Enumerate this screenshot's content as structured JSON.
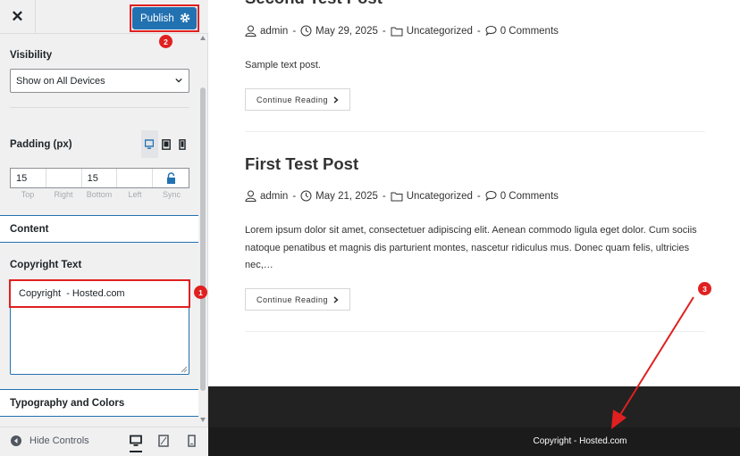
{
  "topbar": {
    "close_glyph": "✕",
    "publish_label": "Publish",
    "close_icon": "close-icon",
    "settings_icon": "gear-icon"
  },
  "panel": {
    "visibility_label": "Visibility",
    "visibility_value": "Show on All Devices",
    "padding_label": "Padding (px)",
    "padding": {
      "values": [
        "15",
        "",
        "15",
        ""
      ],
      "sub_labels": [
        "Top",
        "Right",
        "Bottom",
        "Left",
        "Sync"
      ]
    },
    "content_heading": "Content",
    "copyright_label": "Copyright Text",
    "copyright_value": "Copyright  - Hosted.com",
    "typography_heading": "Typography and Colors"
  },
  "footer_controls": {
    "hide_controls_label": "Hide Controls"
  },
  "preview": {
    "posts": [
      {
        "title": "Second Test Post",
        "author": "admin",
        "date": "May 29, 2025",
        "category": "Uncategorized",
        "comments": "0 Comments",
        "excerpt": "Sample text post.",
        "button": "Continue Reading"
      },
      {
        "title": "First Test Post",
        "author": "admin",
        "date": "May 21, 2025",
        "category": "Uncategorized",
        "comments": "0 Comments",
        "excerpt_lines": [
          "Lorem ipsum dolor sit amet, consectetuer adipiscing elit. Aenean commodo ligula eget dolor. Cum sociis",
          "natoque penatibus et magnis dis parturient montes, nascetur ridiculus mus. Donec quam felis, ultricies",
          "nec,…"
        ],
        "button": "Continue Reading"
      }
    ],
    "separator": "-",
    "footer_copyright": "Copyright - Hosted.com"
  },
  "annotations": {
    "badges": [
      "1",
      "2",
      "3"
    ],
    "color": "#e02020"
  },
  "colors": {
    "accent": "#2271b1",
    "footer_dark": "#222222"
  }
}
